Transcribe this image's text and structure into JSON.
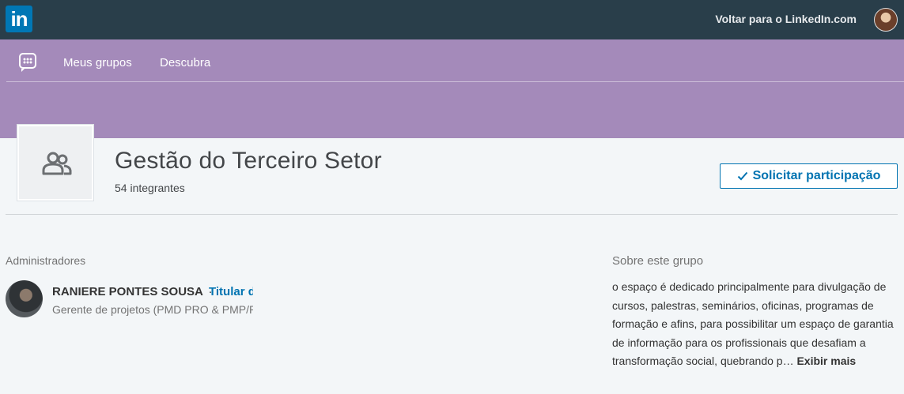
{
  "topbar": {
    "logo_text": "in",
    "back_link": "Voltar para o LinkedIn.com"
  },
  "group_nav": {
    "items": [
      {
        "label": "Meus grupos"
      },
      {
        "label": "Descubra"
      }
    ]
  },
  "group": {
    "title": "Gestão do Terceiro Setor",
    "member_count": "54 integrantes",
    "join_label": "Solicitar participação",
    "join_icon": "checkmark-icon"
  },
  "admins": {
    "heading": "Administradores",
    "list": [
      {
        "name": "RANIERE PONTES SOUSA",
        "separator": "·",
        "role": "Titular do grupo",
        "headline": "Gerente de projetos (PMD PRO & PMP/PMI)"
      }
    ]
  },
  "about": {
    "heading": "Sobre este grupo",
    "description": "o espaço é dedicado principalmente para divulgação de cursos, palestras, seminários, oficinas, programas de formação e afins, para possibilitar um espaço de garantia de informação para os profissionais que desafiam a transformação social, quebrando p…",
    "show_more": "Exibir mais"
  },
  "colors": {
    "topbar": "#293e4a",
    "group_banner": "#a48aba",
    "accent": "#0073b1",
    "background": "#f3f6f8"
  }
}
